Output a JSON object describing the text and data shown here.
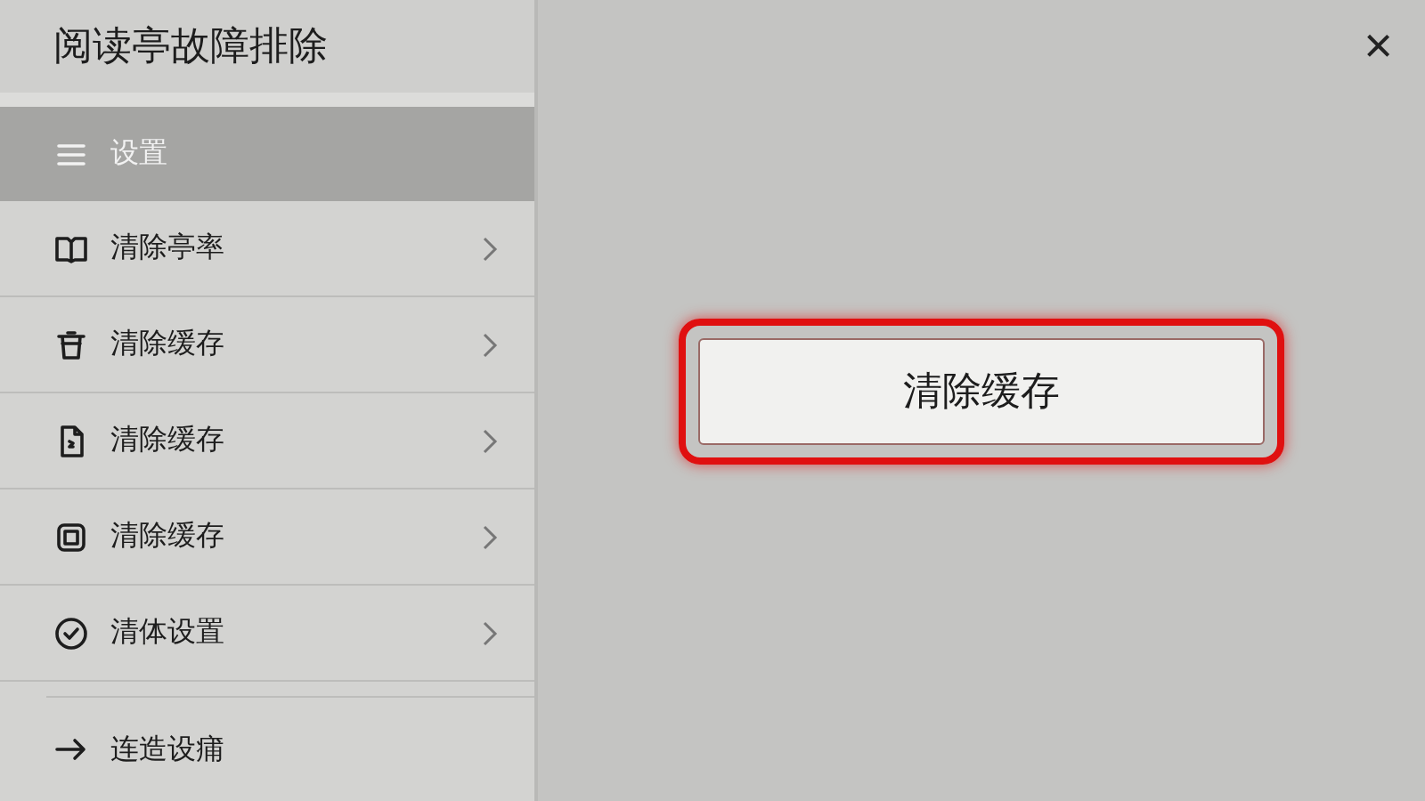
{
  "window": {
    "title": "阅读亭故障排除",
    "close": "×"
  },
  "sidebar": {
    "items": [
      {
        "label": "设置",
        "kind": "menu",
        "selected": true,
        "has_submenu": false
      },
      {
        "label": "清除亭率",
        "kind": "book",
        "selected": false,
        "has_submenu": true
      },
      {
        "label": "清除缓存",
        "kind": "trash",
        "selected": false,
        "has_submenu": true
      },
      {
        "label": "清除缓存",
        "kind": "file",
        "selected": false,
        "has_submenu": true
      },
      {
        "label": "清除缓存",
        "kind": "square",
        "selected": false,
        "has_submenu": true
      },
      {
        "label": "清体设置",
        "kind": "check",
        "selected": false,
        "has_submenu": true
      }
    ],
    "footer": {
      "label": "连造设痡",
      "kind": "arrow"
    }
  },
  "main": {
    "button": {
      "label": "清除缓存",
      "highlighted": true
    }
  }
}
